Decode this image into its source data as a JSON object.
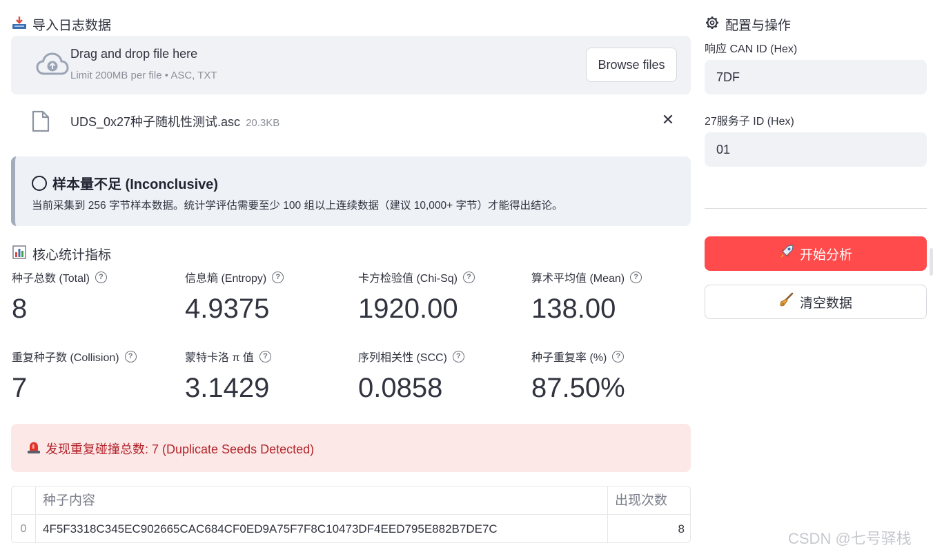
{
  "upload": {
    "section_icon": "inbox-tray-icon",
    "section_title": "导入日志数据",
    "drop_title": "Drag and drop file here",
    "drop_limit": "Limit 200MB per file • ASC, TXT",
    "browse_label": "Browse files",
    "file_name": "UDS_0x27种子随机性测试.asc",
    "file_size": "20.3KB"
  },
  "verdict": {
    "title": "样本量不足 (Inconclusive)",
    "body": "当前采集到 256 字节样本数据。统计学评估需要至少 100 组以上连续数据（建议 10,000+ 字节）才能得出结论。"
  },
  "metrics": {
    "section_icon": "bar-chart-icon",
    "section_title": "核心统计指标",
    "items": [
      {
        "label": "种子总数 (Total)",
        "value": "8"
      },
      {
        "label": "信息熵 (Entropy)",
        "value": "4.9375"
      },
      {
        "label": "卡方检验值 (Chi-Sq)",
        "value": "1920.00"
      },
      {
        "label": "算术平均值 (Mean)",
        "value": "138.00"
      },
      {
        "label": "重复种子数 (Collision)",
        "value": "7"
      },
      {
        "label": "蒙特卡洛 π 值",
        "value": "3.1429"
      },
      {
        "label": "序列相关性 (SCC)",
        "value": "0.0858"
      },
      {
        "label": "种子重复率 (%)",
        "value": "87.50%"
      }
    ]
  },
  "collision_alert": {
    "icon": "siren-icon",
    "text": "发现重复碰撞总数: 7 (Duplicate Seeds Detected)"
  },
  "table": {
    "headers": [
      "种子内容",
      "出现次数"
    ],
    "rows": [
      {
        "index": "0",
        "seed": "4F5F3318C345EC902665CAC684CF0ED9A75F7F8C10473DF4EED795E882B7DE7C",
        "count": "8"
      }
    ]
  },
  "sidebar": {
    "section_icon": "gear-icon",
    "section_title": "配置与操作",
    "can_id_label": "响应 CAN ID (Hex)",
    "can_id_value": "7DF",
    "sub_id_label": "27服务子 ID (Hex)",
    "sub_id_value": "01",
    "start_label": "开始分析",
    "clear_label": "清空数据"
  },
  "watermark": "CSDN @七号驿栈",
  "colors": {
    "primary": "#ff4b4b",
    "error_bg": "#fde8e8",
    "error_text": "#b3262b",
    "info_bg": "#eef1f6"
  }
}
